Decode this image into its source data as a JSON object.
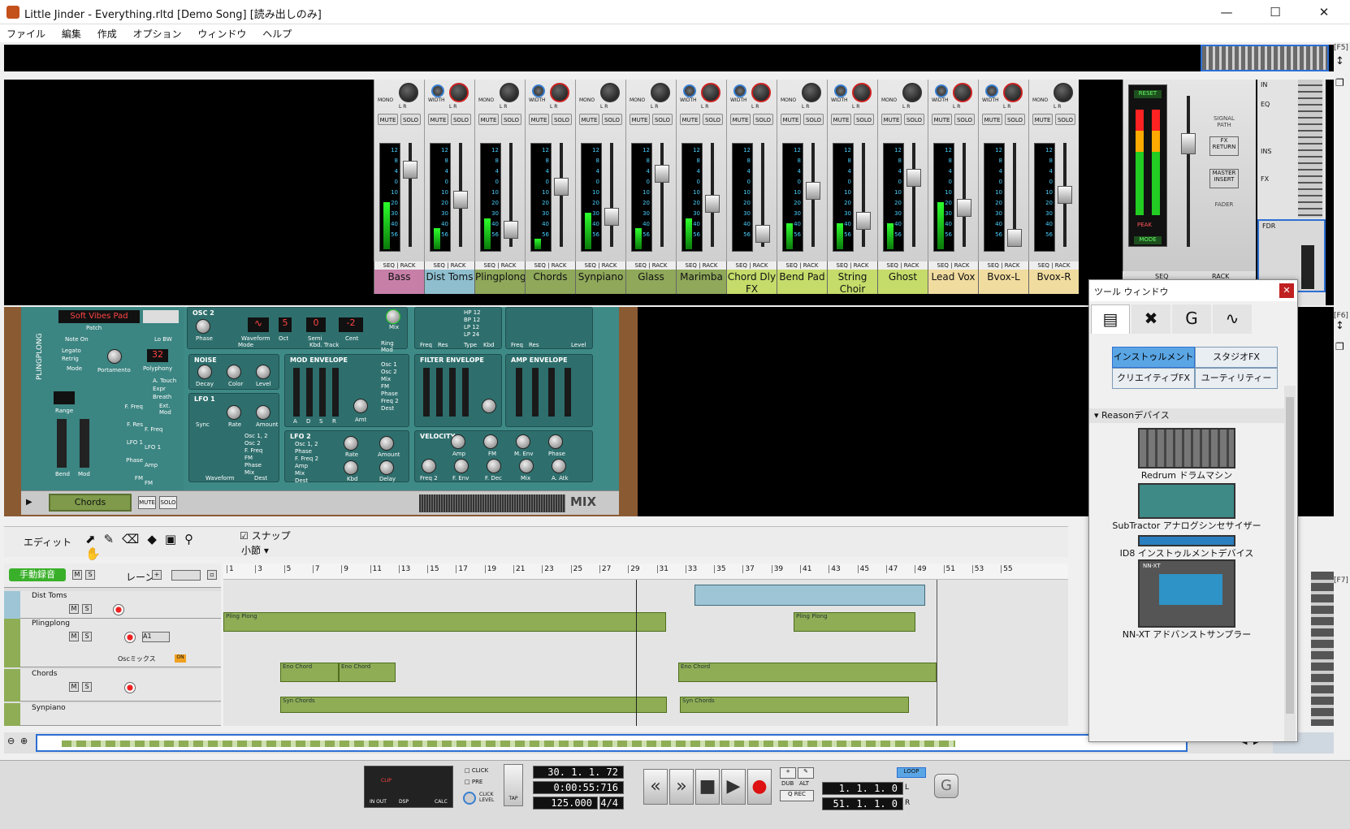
{
  "app": {
    "title": "Little Jinder - Everything.rltd [Demo Song] [読み出しのみ]",
    "menu": [
      "ファイル",
      "編集",
      "作成",
      "オプション",
      "ウィンドウ",
      "ヘルプ"
    ]
  },
  "fkeys": {
    "f5": "[F5]",
    "f6": "[F6]",
    "f7": "[F7]"
  },
  "mixer": {
    "channels": [
      {
        "name": "Bass",
        "color": "#c77fa8",
        "mode": "MONO",
        "level": 0.45
      },
      {
        "name": "Dist Toms",
        "color": "#8fbfcf",
        "mode": "WIDTH",
        "level": 0.2
      },
      {
        "name": "Plingplong",
        "color": "#8fa85a",
        "mode": "MONO",
        "level": 0.3
      },
      {
        "name": "Chords",
        "color": "#8fa85a",
        "mode": "WIDTH",
        "level": 0.1
      },
      {
        "name": "Synpiano",
        "color": "#8fa85a",
        "mode": "MONO",
        "level": 0.35
      },
      {
        "name": "Glass",
        "color": "#8fa85a",
        "mode": "MONO",
        "level": 0.2
      },
      {
        "name": "Marimba",
        "color": "#8fa85a",
        "mode": "WIDTH",
        "level": 0.3
      },
      {
        "name": "Chord Dly FX",
        "color": "#c5dc6a",
        "mode": "WIDTH",
        "level": 0.0
      },
      {
        "name": "Bend Pad",
        "color": "#c5dc6a",
        "mode": "MONO",
        "level": 0.25
      },
      {
        "name": "String Choir",
        "color": "#c5dc6a",
        "mode": "WIDTH",
        "level": 0.25
      },
      {
        "name": "Ghost",
        "color": "#c5dc6a",
        "mode": "MONO",
        "level": 0.25
      },
      {
        "name": "Lead Vox",
        "color": "#f1dca0",
        "mode": "WIDTH",
        "level": 0.45
      },
      {
        "name": "Bvox-L",
        "color": "#f1dca0",
        "mode": "WIDTH",
        "level": 0.0
      },
      {
        "name": "Bvox-R",
        "color": "#f1dca0",
        "mode": "MONO",
        "level": 0.0
      }
    ],
    "strip_labels": {
      "mute": "MUTE",
      "solo": "SOLO",
      "seq": "SEQ",
      "rack": "RACK",
      "lr": "L    R"
    },
    "meter_scale": [
      "12",
      "8",
      "4",
      "0",
      "10",
      "20",
      "30",
      "40",
      "56"
    ],
    "master": {
      "reset": "RESET",
      "peak": "PEAK",
      "mode": "MODE",
      "signal_path": "SIGNAL PATH",
      "fx_return": "FX RETURN",
      "master_insert": "MASTER INSERT",
      "fader": "FADER",
      "seq": "SEQ",
      "rack": "RACK"
    },
    "right_panel": {
      "in": "IN",
      "eq": "EQ",
      "ins": "INS",
      "fx": "FX",
      "fdr": "FDR"
    }
  },
  "rack": {
    "patch_name": "Soft Vibes Pad",
    "patch_label": "Patch",
    "note_on": "Note On",
    "legato": "Legato",
    "retrig": "Retrig",
    "mode": "Mode",
    "portamento": "Portamento",
    "lo_bw": "Lo BW",
    "polyphony": "Polyphony",
    "polyphony_value": "32",
    "velocity_opts": [
      "A. Touch",
      "Expr",
      "Breath"
    ],
    "ext_mod": "Ext. Mod",
    "range": "Range",
    "bend": "Bend",
    "mod": "Mod",
    "left_knobs": [
      "F. Freq",
      "F. Res",
      "LFO 1",
      "Phase",
      "FM"
    ],
    "mod_knobs": [
      "F. Freq",
      "LFO 1",
      "Amp",
      "FM"
    ],
    "osc2": {
      "title": "OSC 2",
      "waveform": "Waveform",
      "oct": "Oct",
      "oct_val": "5",
      "semi": "Semi",
      "semi_val": "0",
      "cent": "Cent",
      "cent_val": "-2",
      "phase": "Phase",
      "mode": "Mode",
      "kbd_track": "Kbd. Track",
      "mix": "Mix",
      "ring_mod": "Ring Mod"
    },
    "noise": {
      "title": "NOISE",
      "knobs": [
        "Decay",
        "Color",
        "Level"
      ]
    },
    "lfo1": {
      "title": "LFO 1",
      "knobs": [
        "Sync",
        "Rate",
        "Amount"
      ],
      "dest": [
        "Osc 1, 2",
        "Osc 2",
        "F. Freq",
        "FM",
        "Phase",
        "Mix"
      ],
      "waveform": "Waveform",
      "dest_label": "Dest"
    },
    "mod_env": {
      "title": "MOD ENVELOPE",
      "adsr": [
        "A",
        "D",
        "S",
        "R"
      ],
      "amt": "Amt",
      "dest": [
        "Osc 1",
        "Osc 2",
        "Mix",
        "FM",
        "Phase",
        "Freq 2"
      ],
      "dest_label": "Dest"
    },
    "filter": {
      "title": "FILTER ENVELOPE",
      "types": [
        "HP 12",
        "BP 12",
        "LP 12",
        "LP 24"
      ],
      "freq": "Freq",
      "res": "Res",
      "type": "Type",
      "kbd": "Kbd"
    },
    "amp_env": {
      "title": "AMP ENVELOPE",
      "freq": "Freq",
      "res": "Res",
      "level": "Level"
    },
    "lfo2": {
      "title": "LFO 2",
      "dest": [
        "Osc 1, 2",
        "Phase",
        "F. Freq 2",
        "Amp",
        "Mix"
      ],
      "knobs": [
        "Rate",
        "Amount",
        "Kbd",
        "Delay"
      ],
      "dest_label": "Dest"
    },
    "velocity": {
      "title": "VELOCITY",
      "knobs": [
        "Amp",
        "FM",
        "M. Env",
        "Phase",
        "Freq 2",
        "F. Env",
        "F. Dec",
        "Mix",
        "A. Atk"
      ]
    },
    "combinator_name": "Chords",
    "mute": "MUTE",
    "solo": "SOLO",
    "mix_label": "MIX",
    "device_side_label": "PLINGPLONG"
  },
  "sequencer": {
    "edit_label": "エディット",
    "snap_label": "スナップ",
    "snap_value": "小節",
    "record_mode": "手動録音",
    "lanes_label": "レーン",
    "m": "M",
    "s": "S",
    "ruler": [
      "1",
      "3",
      "5",
      "7",
      "9",
      "11",
      "13",
      "15",
      "17",
      "19",
      "21",
      "23",
      "25",
      "27",
      "29",
      "31",
      "33",
      "35",
      "37",
      "39",
      "41",
      "43",
      "45",
      "47",
      "49",
      "51",
      "53",
      "55"
    ],
    "tracks": [
      {
        "name": "Dist Toms"
      },
      {
        "name": "Plingplong",
        "sel": "A1",
        "lane": "Oscミックス",
        "on": "ON"
      },
      {
        "name": "Chords"
      },
      {
        "name": "Synpiano"
      }
    ],
    "clips": {
      "pling": "Pling Plong",
      "eno": "Eno Chord",
      "syn": "Syn Chords"
    }
  },
  "transport": {
    "click": "CLICK",
    "pre": "PRE",
    "click_level": "CLICK LEVEL",
    "tap": "TAP",
    "in_out": "IN  OUT",
    "dsp": "DSP",
    "calc": "CALC",
    "clip": "CLIP",
    "position": "30. 1. 1.  72",
    "time": "0:00:55:716",
    "tempo": "125.000",
    "signature": "4/4",
    "dub": "DUB",
    "alt": "ALT",
    "q_rec": "Q REC",
    "loop": "LOOP",
    "loop_l": "1.  1.  1.    0",
    "loop_r": "51.  1.  1.    0",
    "l": "L",
    "r": "R"
  },
  "tool_window": {
    "title": "ツール ウィンドウ",
    "categories": [
      "インストゥルメント",
      "スタジオFX",
      "クリエイティブFX",
      "ユーティリティー"
    ],
    "section": "Reasonデバイス",
    "devices": [
      "Redrum ドラムマシン",
      "SubTractor アナログシンセサイザー",
      "ID8 インストゥルメントデバイス",
      "NN-XT アドバンストサンプラー"
    ],
    "device_badge": "NN-XT"
  }
}
